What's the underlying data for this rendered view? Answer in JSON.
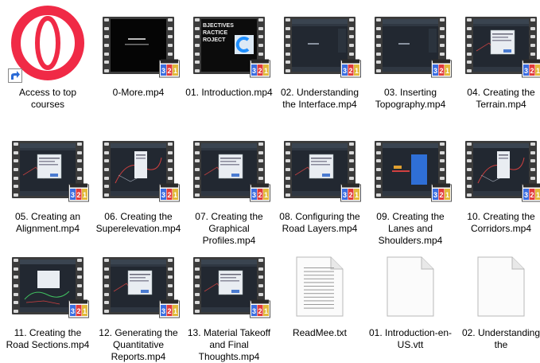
{
  "colors": {
    "opera_red": "#f02a46",
    "film": "#3b3b3b",
    "screen_dark": "#1e2329",
    "accent_blue": "#1f8fff"
  },
  "items": [
    {
      "name": "access-to-top-courses-shortcut",
      "label": "Access to top courses",
      "icon": "opera-icon",
      "kind": "shortcut"
    },
    {
      "name": "file-0-more",
      "label": "0-More.mp4",
      "icon": "video-file-icon",
      "kind": "video",
      "thumb": "black"
    },
    {
      "name": "file-01-introduction",
      "label": "01. Introduction.mp4",
      "icon": "video-file-icon",
      "kind": "video",
      "thumb": "intro",
      "thumb_text": "BJECTIVES\nRACTICE\nROJECT"
    },
    {
      "name": "file-02-understanding-interface",
      "label": "02. Understanding the Interface.mp4",
      "icon": "video-file-icon",
      "kind": "video",
      "thumb": "cad"
    },
    {
      "name": "file-03-inserting-topography",
      "label": "03. Inserting Topography.mp4",
      "icon": "video-file-icon",
      "kind": "video",
      "thumb": "cad"
    },
    {
      "name": "file-04-creating-terrain",
      "label": "04. Creating the Terrain.mp4",
      "icon": "video-file-icon",
      "kind": "video",
      "thumb": "cad-dialog"
    },
    {
      "name": "file-05-creating-alignment",
      "label": "05. Creating an Alignment.mp4",
      "icon": "video-file-icon",
      "kind": "video",
      "thumb": "cad-dialog"
    },
    {
      "name": "file-06-creating-superelevation",
      "label": "06. Creating the Superelevation.mp4",
      "icon": "video-file-icon",
      "kind": "video",
      "thumb": "cad-red"
    },
    {
      "name": "file-07-creating-graphical-profiles",
      "label": "07. Creating the Graphical Profiles.mp4",
      "icon": "video-file-icon",
      "kind": "video",
      "thumb": "cad-dialog"
    },
    {
      "name": "file-08-configuring-road-layers",
      "label": "08. Configuring the Road Layers.mp4",
      "icon": "video-file-icon",
      "kind": "video",
      "thumb": "cad-dialog"
    },
    {
      "name": "file-09-creating-lanes-shoulders",
      "label": "09. Creating the Lanes and Shoulders.mp4",
      "icon": "video-file-icon",
      "kind": "video",
      "thumb": "cad-blue"
    },
    {
      "name": "file-10-creating-corridors",
      "label": "10. Creating the Corridors.mp4",
      "icon": "video-file-icon",
      "kind": "video",
      "thumb": "cad-red"
    },
    {
      "name": "file-11-creating-road-sections",
      "label": "11. Creating the Road Sections.mp4",
      "icon": "video-file-icon",
      "kind": "video",
      "thumb": "cad-green"
    },
    {
      "name": "file-12-generating-quantitative-reports",
      "label": "12. Generating the Quantitative Reports.mp4",
      "icon": "video-file-icon",
      "kind": "video",
      "thumb": "cad-dialog"
    },
    {
      "name": "file-13-material-takeoff",
      "label": "13. Material Takeoff and Final Thoughts.mp4",
      "icon": "video-file-icon",
      "kind": "video",
      "thumb": "cad-dialog"
    },
    {
      "name": "file-readmee-txt",
      "label": "ReadMee.txt",
      "icon": "text-file-icon",
      "kind": "text"
    },
    {
      "name": "file-01-introduction-vtt",
      "label": "01. Introduction-en-US.vtt",
      "icon": "blank-file-icon",
      "kind": "blank"
    },
    {
      "name": "file-02-understanding-vtt",
      "label": "02. Understanding the",
      "icon": "blank-file-icon",
      "kind": "blank"
    }
  ]
}
